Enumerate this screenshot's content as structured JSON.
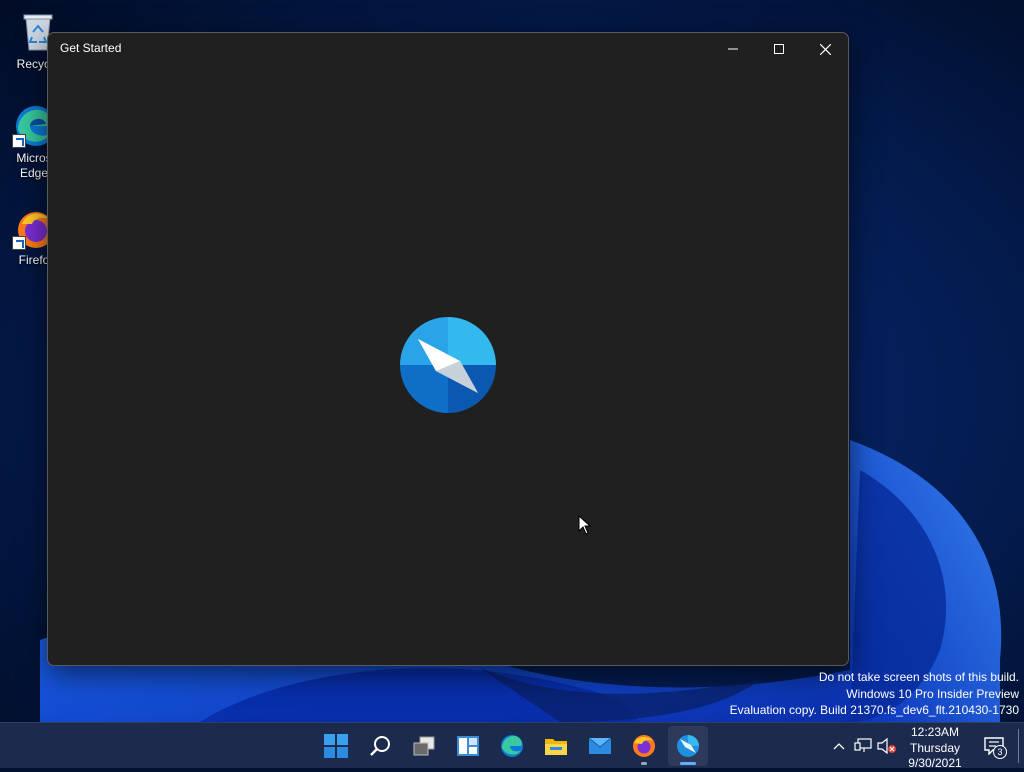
{
  "desktop": {
    "icons": [
      {
        "label": "Recycle",
        "icon": "recycle-bin-icon"
      },
      {
        "label": "Micros\nEdge",
        "icon": "edge-icon"
      },
      {
        "label": "Firefo",
        "icon": "firefox-icon"
      }
    ]
  },
  "window": {
    "title": "Get Started",
    "controls": [
      "minimize-icon",
      "maximize-icon",
      "close-icon"
    ],
    "splash_icon": "get-started-compass-icon"
  },
  "watermark": {
    "line1": "Do not take screen shots of this build.",
    "line2": "Windows 10 Pro Insider Preview",
    "line3": "Evaluation copy. Build 21370.fs_dev6_flt.210430-1730"
  },
  "taskbar": {
    "apps": [
      {
        "name": "start",
        "icon": "windows-start-icon"
      },
      {
        "name": "search",
        "icon": "search-icon"
      },
      {
        "name": "task-view",
        "icon": "task-view-icon"
      },
      {
        "name": "widgets",
        "icon": "widgets-icon"
      },
      {
        "name": "edge",
        "icon": "edge-icon"
      },
      {
        "name": "file-explorer",
        "icon": "folder-icon"
      },
      {
        "name": "mail",
        "icon": "mail-icon"
      },
      {
        "name": "firefox",
        "icon": "firefox-icon",
        "running": true
      },
      {
        "name": "get-started",
        "icon": "get-started-compass-icon",
        "running": true,
        "active": true
      }
    ],
    "tray": {
      "icons": [
        "chevron-up-icon",
        "network-icon",
        "volume-muted-icon"
      ],
      "time": "12:23AM",
      "day": "Thursday",
      "date": "9/30/2021",
      "notification_count": "3"
    }
  },
  "colors": {
    "window_bg": "#202020",
    "taskbar_bg": "#1c2a4e",
    "accent": "#61b0ff",
    "wallpaper_blue": "#0a3fd6"
  }
}
